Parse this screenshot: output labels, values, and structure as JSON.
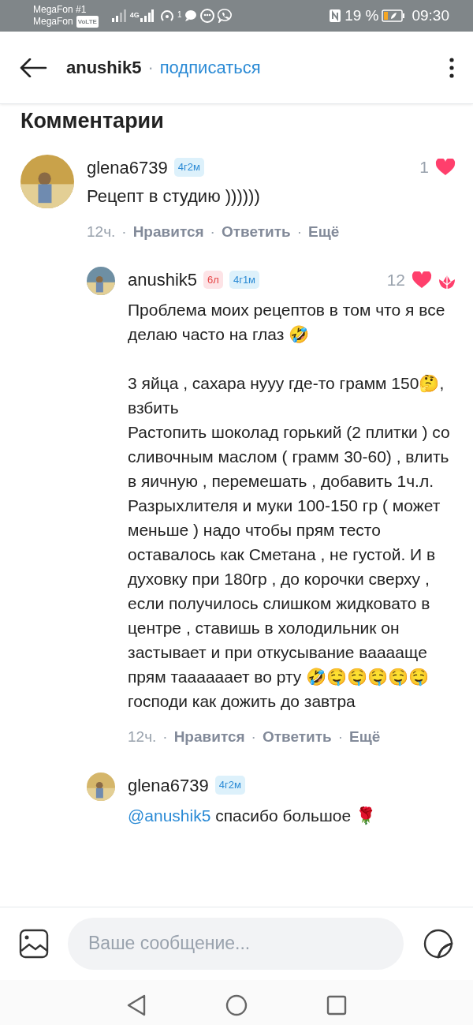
{
  "status_bar": {
    "carrier_1": "MegaFon #1",
    "carrier_2": "MegaFon",
    "volte": "VoLTE",
    "network": "4G",
    "notification_count": "1",
    "battery": "19 %",
    "time": "09:30"
  },
  "header": {
    "username": "anushik5",
    "separator": "·",
    "subscribe": "подписаться"
  },
  "section_title": "Комментарии",
  "comments": [
    {
      "username": "glena6739",
      "badges": [
        {
          "text": "4г2м",
          "kind": "blue"
        }
      ],
      "likes": "1",
      "rose": false,
      "text": "Рецепт в студию ))))))",
      "time": "12ч.",
      "separator": "·",
      "actions": [
        "Нравится",
        "Ответить",
        "Ещё"
      ],
      "reply": false
    },
    {
      "username": "anushik5",
      "badges": [
        {
          "text": "6л",
          "kind": "pink"
        },
        {
          "text": "4г1м",
          "kind": "blue"
        }
      ],
      "likes": "12",
      "rose": true,
      "text": "Проблема моих рецептов в том что я все делаю часто на глаз 🤣\n\n3 яйца , сахара нууу где-то грамм 150🤔, взбить\nРастопить шоколад горький (2 плитки ) со сливочным маслом ( грамм 30-60) , влить в яичную , перемешать , добавить 1ч.л. Разрыхлителя и муки 100-150 гр ( может меньше ) надо чтобы прям тесто оставалось как Сметана , не густой. И в духовку при 180гр , до корочки сверху , если получилось слишком жидковато в центре , ставишь в холодильник он застывает и при откусывание ваааащe прям таааааает во рту 🤣🤤🤤🤤🤤🤤 господи как дожить до завтра",
      "time": "12ч.",
      "separator": "·",
      "actions": [
        "Нравится",
        "Ответить",
        "Ещё"
      ],
      "reply": true
    },
    {
      "username": "glena6739",
      "badges": [
        {
          "text": "4г2м",
          "kind": "blue"
        }
      ],
      "rose": false,
      "mention": "@anushik5",
      "text": "спасибо большое 🌹",
      "reply": true
    }
  ],
  "composer": {
    "placeholder": "Ваше сообщение..."
  }
}
